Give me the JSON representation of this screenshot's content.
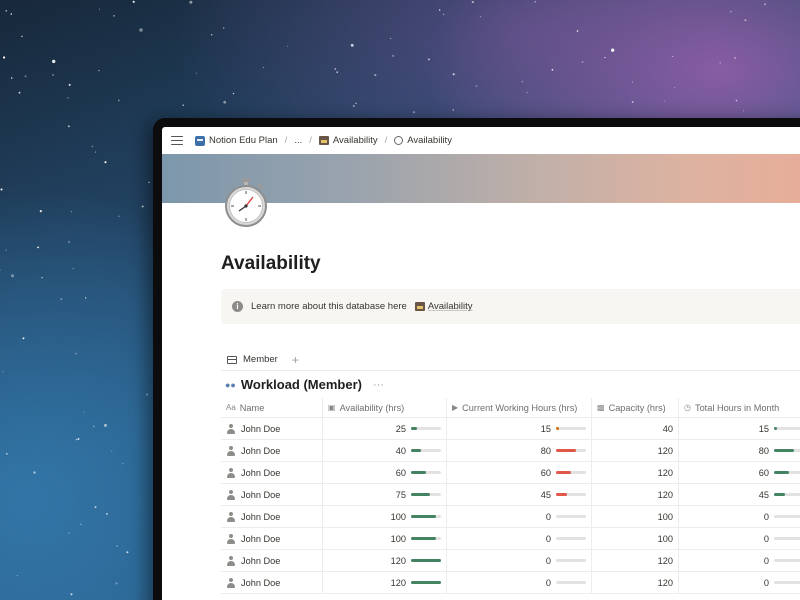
{
  "breadcrumb": {
    "items": [
      "Notion Edu Plan",
      "...",
      "Availability",
      "Availability"
    ],
    "icons": [
      "notion-app-icon",
      null,
      "box-icon",
      "stopwatch-icon"
    ]
  },
  "page": {
    "title": "Availability",
    "callout_text": "Learn more about this database here",
    "callout_link": "Availability"
  },
  "view": {
    "tab_label": "Member",
    "add_label": "+"
  },
  "group": {
    "title": "Workload (Member)",
    "more_label": "···"
  },
  "table": {
    "columns": [
      "Name",
      "Availability (hrs)",
      "Current Working Hours (hrs)",
      "Capacity (hrs)",
      "Total Hours in Month"
    ],
    "bar_colors": {
      "green": "#448361",
      "red": "#e0574a",
      "orange": "#d9730d",
      "track": "#e3e2e0"
    },
    "rows": [
      {
        "name": "John Doe",
        "availability": "25",
        "avail_bar": 0.21,
        "current": "15",
        "cur_bar": 0.1,
        "cur_color": "orange",
        "capacity": "40",
        "total": "15",
        "total_bar": 0.1
      },
      {
        "name": "John Doe",
        "availability": "40",
        "avail_bar": 0.33,
        "current": "80",
        "cur_bar": 0.67,
        "cur_color": "red",
        "capacity": "120",
        "total": "80",
        "total_bar": 0.67
      },
      {
        "name": "John Doe",
        "availability": "60",
        "avail_bar": 0.5,
        "current": "60",
        "cur_bar": 0.5,
        "cur_color": "red",
        "capacity": "120",
        "total": "60",
        "total_bar": 0.5
      },
      {
        "name": "John Doe",
        "availability": "75",
        "avail_bar": 0.63,
        "current": "45",
        "cur_bar": 0.38,
        "cur_color": "red",
        "capacity": "120",
        "total": "45",
        "total_bar": 0.38
      },
      {
        "name": "John Doe",
        "availability": "100",
        "avail_bar": 0.83,
        "current": "0",
        "cur_bar": 0,
        "cur_color": "red",
        "capacity": "100",
        "total": "0",
        "total_bar": 0
      },
      {
        "name": "John Doe",
        "availability": "100",
        "avail_bar": 0.83,
        "current": "0",
        "cur_bar": 0,
        "cur_color": "red",
        "capacity": "100",
        "total": "0",
        "total_bar": 0
      },
      {
        "name": "John Doe",
        "availability": "120",
        "avail_bar": 1.0,
        "current": "0",
        "cur_bar": 0,
        "cur_color": "red",
        "capacity": "120",
        "total": "0",
        "total_bar": 0
      },
      {
        "name": "John Doe",
        "availability": "120",
        "avail_bar": 1.0,
        "current": "0",
        "cur_bar": 0,
        "cur_color": "red",
        "capacity": "120",
        "total": "0",
        "total_bar": 0
      }
    ]
  }
}
